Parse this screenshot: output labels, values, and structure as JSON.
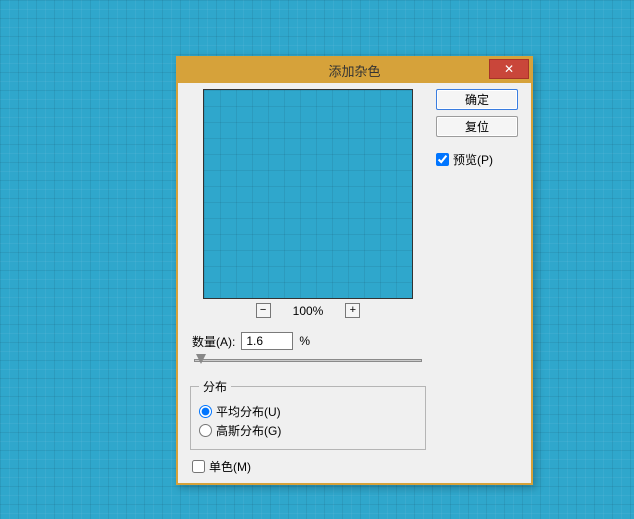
{
  "dialog": {
    "title": "添加杂色",
    "close_symbol": "✕"
  },
  "buttons": {
    "ok": "确定",
    "reset": "复位"
  },
  "preview": {
    "label": "预览(P)",
    "checked": true
  },
  "zoom": {
    "out": "−",
    "level": "100%",
    "in": "+"
  },
  "amount": {
    "label": "数量(A):",
    "value": "1.6",
    "unit": "%"
  },
  "distribution": {
    "legend": "分布",
    "options": {
      "uniform": "平均分布(U)",
      "gaussian": "高斯分布(G)"
    },
    "selected": "uniform"
  },
  "mono": {
    "label": "单色(M)",
    "checked": false
  }
}
